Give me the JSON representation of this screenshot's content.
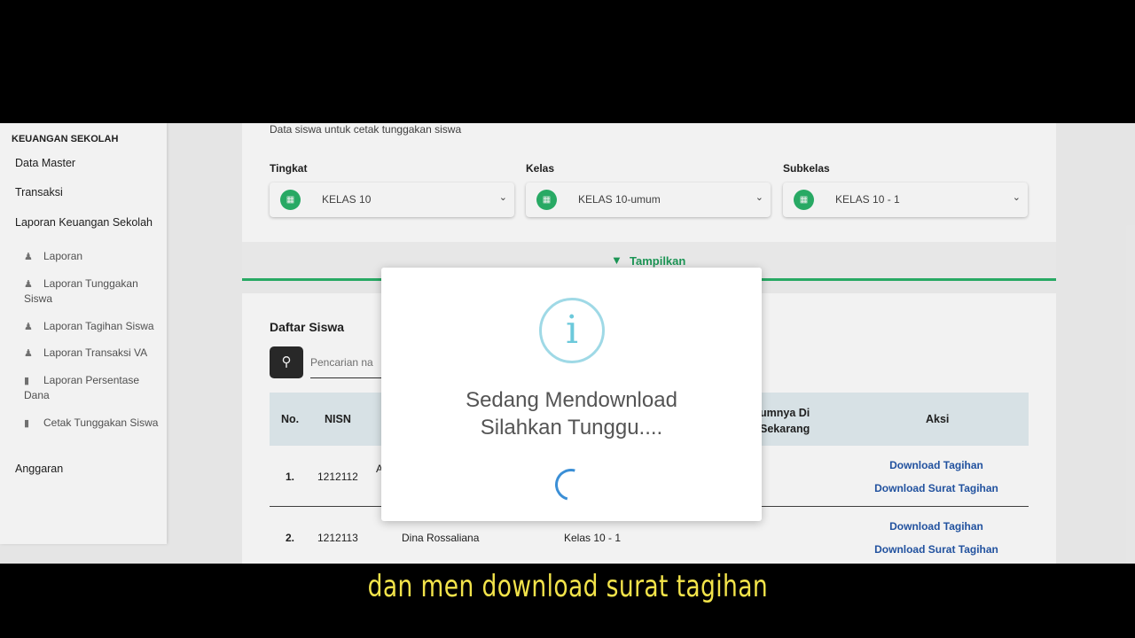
{
  "sidebar": {
    "heading": "KEUANGAN SEKOLAH",
    "items": [
      "Data Master",
      "Transaksi",
      "Laporan Keuangan Sekolah",
      "Anggaran"
    ],
    "subitems": [
      {
        "label": "Laporan",
        "icon": "user-gear-icon"
      },
      {
        "label": "Laporan Tunggakan Siswa",
        "icon": "user-gear-icon"
      },
      {
        "label": "Laporan Tagihan Siswa",
        "icon": "user-gear-icon"
      },
      {
        "label": "Laporan Transaksi VA",
        "icon": "user-gear-icon"
      },
      {
        "label": "Laporan Persentase Dana",
        "icon": "book-icon"
      },
      {
        "label": "Cetak Tunggakan Siswa",
        "icon": "book-icon"
      }
    ]
  },
  "filter": {
    "subtitle": "Data siswa untuk cetak tunggakan siswa",
    "tingkat_label": "Tingkat",
    "tingkat_value": "KELAS 10",
    "kelas_label": "Kelas",
    "kelas_value": "KELAS 10-umum",
    "subkelas_label": "Subkelas",
    "subkelas_value": "KELAS 10 - 1",
    "show_button": "Tampilkan",
    "accent": "#2bb36a"
  },
  "list": {
    "title": "Daftar Siswa",
    "search_placeholder": "Pencarian na",
    "headers": {
      "no": "No.",
      "nisn": "NISN",
      "partial": "umnya Di\nSekarang",
      "aksi": "Aksi"
    },
    "rows": [
      {
        "no": "1.",
        "nisn": "1212112",
        "name": "A",
        "kelas": "",
        "act1": "Download Tagihan",
        "act2": "Download Surat Tagihan"
      },
      {
        "no": "2.",
        "nisn": "1212113",
        "name": "Dina Rossaliana",
        "kelas": "Kelas 10 - 1",
        "act1": "Download Tagihan",
        "act2": "Download Surat Tagihan"
      }
    ],
    "link_color": "#2457a8"
  },
  "modal": {
    "icon": "info-icon",
    "line1": "Sedang Mendownload",
    "line2": "Silahkan Tunggu...."
  },
  "caption": "dan men download surat tagihan"
}
